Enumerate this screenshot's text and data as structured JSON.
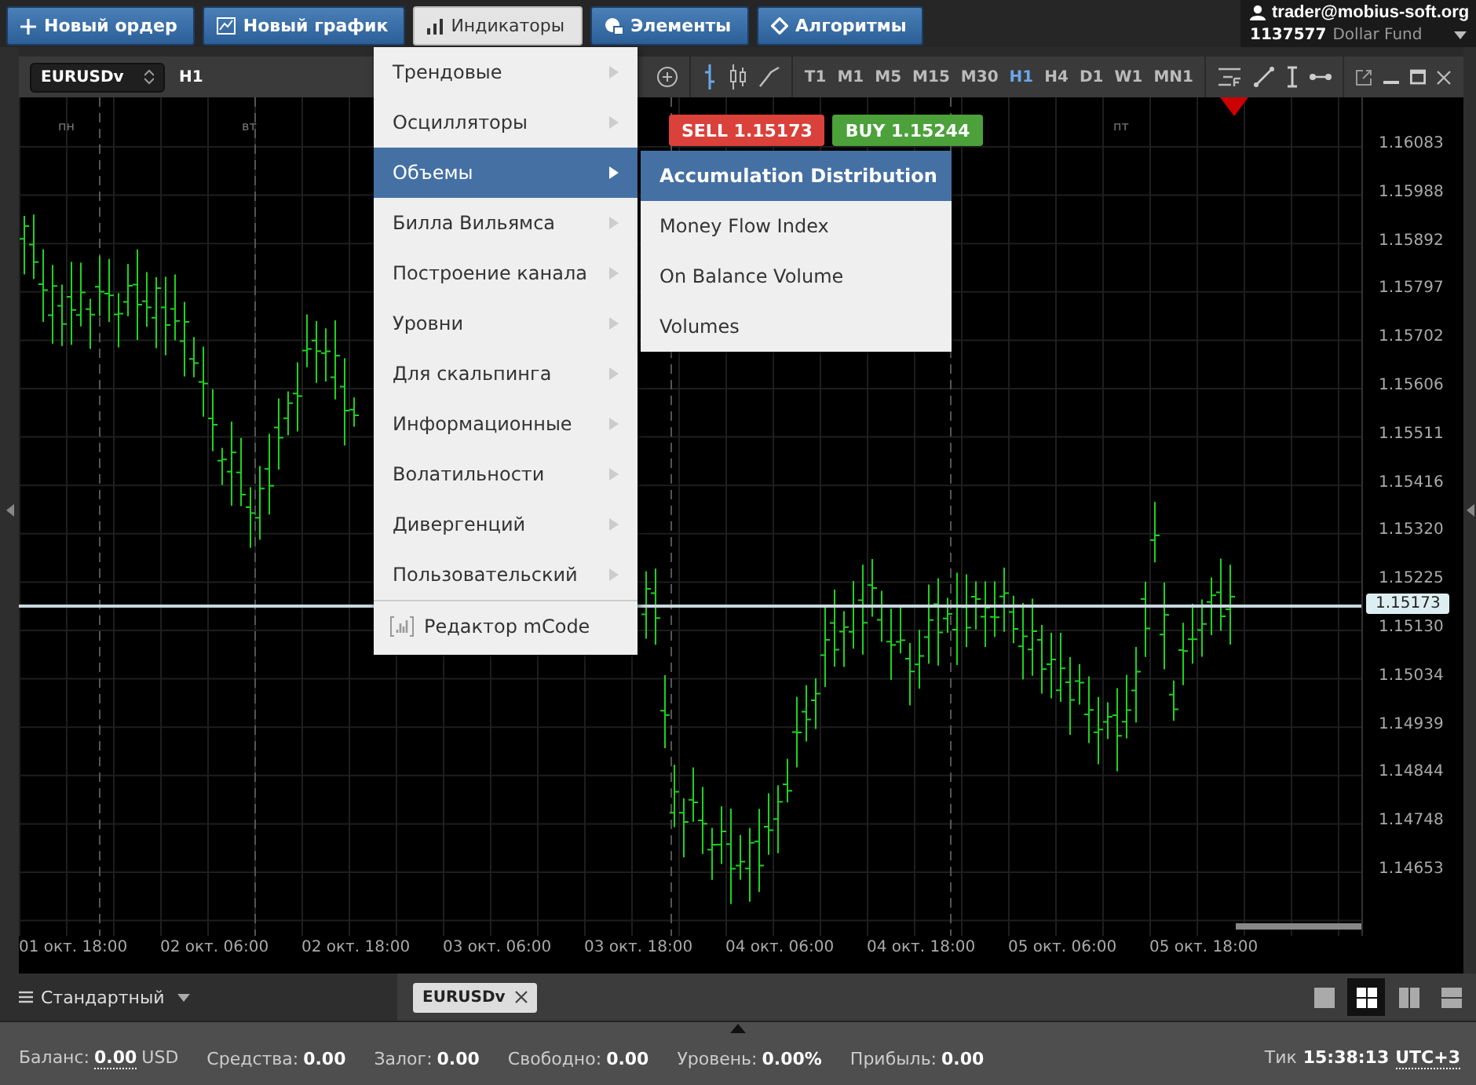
{
  "toolbar": {
    "buttons": [
      {
        "label": "Новый ордер",
        "selected": false
      },
      {
        "label": "Новый график",
        "selected": false
      },
      {
        "label": "Индикаторы",
        "selected": true
      },
      {
        "label": "Элементы",
        "selected": false
      },
      {
        "label": "Алгоритмы",
        "selected": false
      }
    ]
  },
  "account": {
    "email": "trader@mobius-soft.org",
    "number": "1137577",
    "name": "Dollar Fund"
  },
  "chart_window": {
    "symbol": "EURUSDv",
    "timeframe": "H1",
    "timeframes": [
      {
        "label": "T1",
        "selected": false
      },
      {
        "label": "M1",
        "selected": false
      },
      {
        "label": "M5",
        "selected": false
      },
      {
        "label": "M15",
        "selected": false
      },
      {
        "label": "M30",
        "selected": false
      },
      {
        "label": "H1",
        "selected": true
      },
      {
        "label": "H4",
        "selected": false
      },
      {
        "label": "D1",
        "selected": false
      },
      {
        "label": "W1",
        "selected": false
      },
      {
        "label": "MN1",
        "selected": false
      }
    ],
    "sell": {
      "label": "SELL",
      "price": "1.15173"
    },
    "buy": {
      "label": "BUY",
      "price": "1.15244"
    },
    "day_labels": [
      "пн",
      "вт",
      "пт"
    ],
    "price_labels": [
      "1.16083",
      "1.15988",
      "1.15892",
      "1.15797",
      "1.15702",
      "1.15606",
      "1.15511",
      "1.15416",
      "1.15320",
      "1.15225",
      "1.15130",
      "1.15034",
      "1.14939",
      "1.14844",
      "1.14748",
      "1.14653"
    ],
    "current_price": "1.15173",
    "time_labels": [
      "01 окт. 18:00",
      "02 окт. 06:00",
      "02 окт. 18:00",
      "03 окт. 06:00",
      "03 окт. 18:00",
      "04 окт. 06:00",
      "04 окт. 18:00",
      "05 окт. 06:00",
      "05 окт. 18:00"
    ]
  },
  "indicators_menu": {
    "items": [
      {
        "label": "Трендовые",
        "selected": false
      },
      {
        "label": "Осцилляторы",
        "selected": false
      },
      {
        "label": "Объемы",
        "selected": true
      },
      {
        "label": "Билла Вильямса",
        "selected": false
      },
      {
        "label": "Построение канала",
        "selected": false
      },
      {
        "label": "Уровни",
        "selected": false
      },
      {
        "label": "Для скальпинга",
        "selected": false
      },
      {
        "label": "Информационные",
        "selected": false
      },
      {
        "label": "Волатильности",
        "selected": false
      },
      {
        "label": "Дивергенций",
        "selected": false
      },
      {
        "label": "Пользовательский",
        "selected": false
      }
    ],
    "editor": "Редактор mCode"
  },
  "submenu": {
    "items": [
      {
        "label": "Accumulation Distribution",
        "selected": true
      },
      {
        "label": "Money Flow Index",
        "selected": false
      },
      {
        "label": "On Balance Volume",
        "selected": false
      },
      {
        "label": "Volumes",
        "selected": false
      }
    ]
  },
  "bottom_tabs": {
    "layout": "Стандартный",
    "tabs": [
      {
        "label": "EURUSDv"
      }
    ],
    "layouts": [
      {
        "selected": false
      },
      {
        "selected": true
      },
      {
        "selected": false
      },
      {
        "selected": false
      }
    ]
  },
  "status_bar": {
    "fields": [
      {
        "label": "Баланс:",
        "value": "0.00",
        "unit": "USD"
      },
      {
        "label": "Средства:",
        "value": "0.00"
      },
      {
        "label": "Залог:",
        "value": "0.00"
      },
      {
        "label": "Свободно:",
        "value": "0.00"
      },
      {
        "label": "Уровень:",
        "value": "0.00%"
      },
      {
        "label": "Прибыль:",
        "value": "0.00"
      }
    ],
    "tick_label": "Тик",
    "time": "15:38:13",
    "timezone": "UTC+3"
  }
}
